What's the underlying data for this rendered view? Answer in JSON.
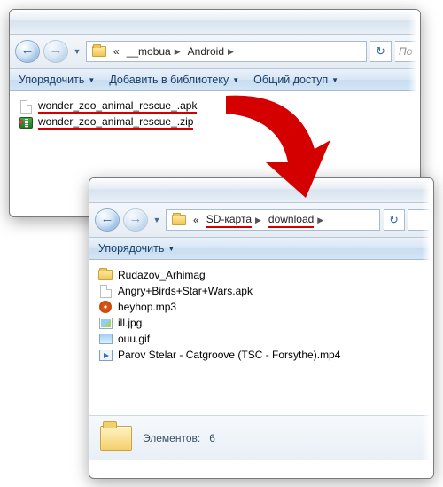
{
  "window1": {
    "breadcrumb": {
      "pre": "«",
      "items": [
        "__mobua",
        "Android"
      ]
    },
    "search_placeholder": "По",
    "toolbar": {
      "organize": "Упорядочить",
      "addlib": "Добавить в библиотеку",
      "share": "Общий доступ"
    },
    "files": [
      {
        "icon": "file",
        "name": "wonder_zoo_animal_rescue_.apk"
      },
      {
        "icon": "zip",
        "name": "wonder_zoo_animal_rescue_.zip"
      }
    ]
  },
  "window2": {
    "breadcrumb": {
      "pre": "«",
      "items": [
        "SD-карта",
        "download"
      ]
    },
    "toolbar": {
      "organize": "Упорядочить"
    },
    "files": [
      {
        "icon": "folder",
        "name": "Rudazov_Arhimag"
      },
      {
        "icon": "file",
        "name": "Angry+Birds+Star+Wars.apk"
      },
      {
        "icon": "mp3",
        "name": "heyhop.mp3"
      },
      {
        "icon": "img",
        "name": "ill.jpg"
      },
      {
        "icon": "gif",
        "name": "ouu.gif"
      },
      {
        "icon": "mp4",
        "name": "Parov Stelar - Catgroove (TSC - Forsythe).mp4"
      }
    ],
    "status": {
      "label": "Элементов:",
      "count": "6"
    }
  }
}
